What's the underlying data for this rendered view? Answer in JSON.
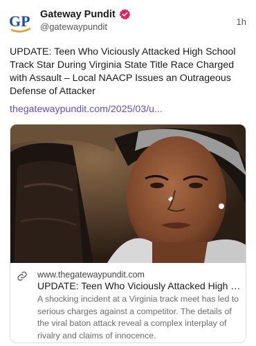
{
  "post": {
    "author_name": "Gateway Pundit",
    "author_handle": "@gatewaypundit",
    "time": "1h",
    "avatar_text": "GP",
    "text": "UPDATE: Teen Who Viciously Attacked High School Track Star During Virginia State Title Race Charged with Assault – Local NAACP Issues an Outrageous Defense of Attacker",
    "link_text": "thegatewaypundit.com/2025/03/u..."
  },
  "card": {
    "domain": "www.thegatewaypundit.com",
    "title": "UPDATE: Teen Who Viciously Attacked High Sc...",
    "description": "A shocking incident at a Virginia track meet has led to serious charges against a competitor. The details of the viral baton attack reveal a complex interplay of rivalry and claims of innocence."
  },
  "colors": {
    "link": "#6a48c8",
    "verified_badge": "#e0245e",
    "avatar_blue": "#1e4fa3",
    "avatar_orange": "#f29a1e"
  },
  "icons": {
    "verified": "verified-badge-icon",
    "link": "link-chain-icon"
  }
}
